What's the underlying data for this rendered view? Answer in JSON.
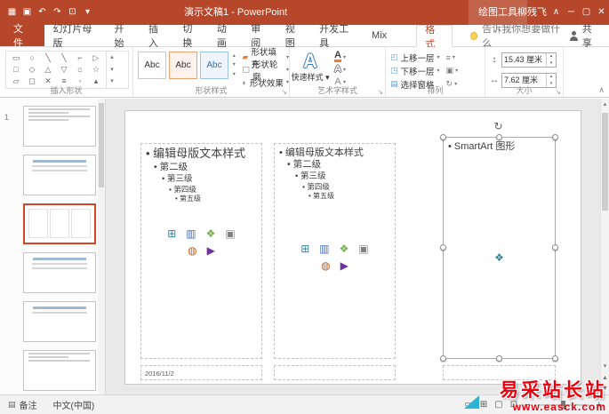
{
  "titlebar": {
    "title": "演示文稿1 - PowerPoint",
    "contextual": "绘图工具",
    "user": "柳残飞"
  },
  "tabs": {
    "file": "文件",
    "items": [
      "幻灯片母版",
      "开始",
      "插入",
      "切换",
      "动画",
      "审阅",
      "视图",
      "开发工具",
      "Mix",
      "格式"
    ],
    "tell_me": "告诉我你想要做什么",
    "share": "共享"
  },
  "ribbon": {
    "insert_shapes": {
      "label": "插入形状",
      "shapes": [
        "▭",
        "○",
        "╲",
        "╲",
        "⌐",
        "▷",
        "□",
        "◇",
        "△",
        "▽",
        "⌂",
        "☆",
        "▱",
        "◻",
        "✕",
        "≡",
        "◦",
        "▴"
      ]
    },
    "shape_styles": {
      "label": "形状样式",
      "preset": "Abc",
      "fill": "形状填充",
      "outline": "形状轮廓",
      "effects": "形状效果"
    },
    "wordart": {
      "label": "艺术字样式",
      "quick": "快速样式",
      "letter": "A"
    },
    "arrange": {
      "label": "排列",
      "forward": "上移一层",
      "backward": "下移一层",
      "pane": "选择窗格"
    },
    "size": {
      "label": "大小",
      "height": "15.43 厘米",
      "width": "7.62 厘米"
    }
  },
  "slide": {
    "number": "1",
    "bullets": {
      "l1": "• 编辑母版文本样式",
      "l2": "• 第二级",
      "l3": "• 第三级",
      "l4": "• 第四级",
      "l5": "• 第五级"
    },
    "smartart": "• SmartArt 图形",
    "date": "2016/11/2"
  },
  "statusbar": {
    "notes": "备注",
    "language": "中文(中国)"
  },
  "watermark": {
    "line1": "易采站长站",
    "line2": "www.easck.com"
  },
  "icons": {
    "touch": "▦",
    "save": "▣",
    "undo": "↶",
    "redo": "↷",
    "slideshow": "⊡",
    "qat_more": "▾",
    "ribbon_options": "∧",
    "minimize": "─",
    "restore": "▢",
    "close": "✕",
    "gallery_up": "▴",
    "gallery_down": "▾",
    "gallery_more": "▾",
    "dropdown": "▾",
    "fill": "▰",
    "outline": "▢",
    "effects": "◐",
    "bring_forward": "◰",
    "send_backward": "◳",
    "selection_pane": "▤",
    "align": "≡",
    "group": "▣",
    "rotate": "↻",
    "height": "↕",
    "width": "↔",
    "spin_up": "▴",
    "spin_down": "▾",
    "launcher": "↘",
    "collapse": "∧",
    "notes": "▤",
    "view_normal": "▭",
    "view_sorter": "⊞",
    "view_reading": "▢",
    "view_show": "⊡",
    "zoom_out": "−",
    "zoom_in": "+",
    "scroll_up": "▴",
    "scroll_down": "▾",
    "prev_slide": "▲",
    "next_slide": "▼",
    "rotate_handle": "↻",
    "table": "⊞",
    "chart": "▥",
    "smartart": "❖",
    "picture": "▣",
    "clipart": "◍",
    "media": "▶"
  },
  "colors": {
    "accent": "#B7472A",
    "thumb_selection": "#D04727",
    "watermark": "#E8000D"
  }
}
